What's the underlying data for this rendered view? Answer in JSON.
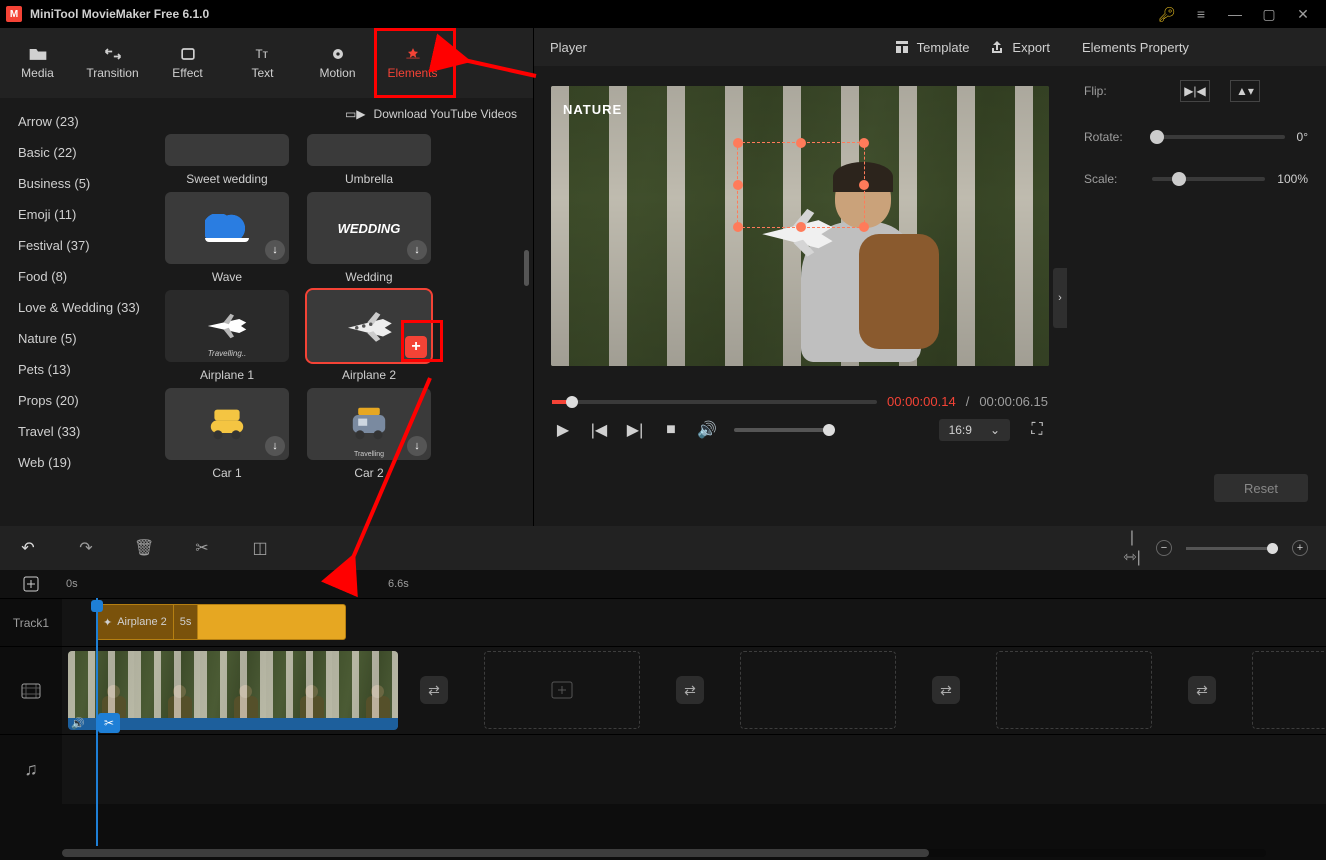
{
  "app_title": "MiniTool MovieMaker Free 6.1.0",
  "tabs": [
    "Media",
    "Transition",
    "Effect",
    "Text",
    "Motion",
    "Elements"
  ],
  "active_tab_index": 5,
  "download_youtube_label": "Download YouTube Videos",
  "categories": [
    "Arrow (23)",
    "Basic (22)",
    "Business (5)",
    "Emoji (11)",
    "Festival (37)",
    "Food (8)",
    "Love & Wedding (33)",
    "Nature (5)",
    "Pets (13)",
    "Props (20)",
    "Travel (33)",
    "Web (19)"
  ],
  "elements_grid": [
    [
      "Sweet wedding",
      "Umbrella"
    ],
    [
      "Wave",
      "Wedding"
    ],
    [
      "Airplane 1",
      "Airplane 2"
    ],
    [
      "Car 1",
      "Car 2"
    ]
  ],
  "player": {
    "title": "Player",
    "template_label": "Template",
    "export_label": "Export",
    "overlay_text": "NATURE",
    "time_current": "00:00:00.14",
    "time_total": "00:00:06.15",
    "aspect_ratio": "16:9"
  },
  "properties": {
    "title": "Elements Property",
    "flip_label": "Flip:",
    "rotate_label": "Rotate:",
    "rotate_value": "0°",
    "scale_label": "Scale:",
    "scale_value": "100%",
    "reset_label": "Reset"
  },
  "timeline": {
    "ruler_marks": {
      "start": "0s",
      "end": "6.6s"
    },
    "tracks": {
      "track1_label": "Track1",
      "element_clip": {
        "name": "Airplane 2",
        "duration": "5s"
      }
    }
  }
}
